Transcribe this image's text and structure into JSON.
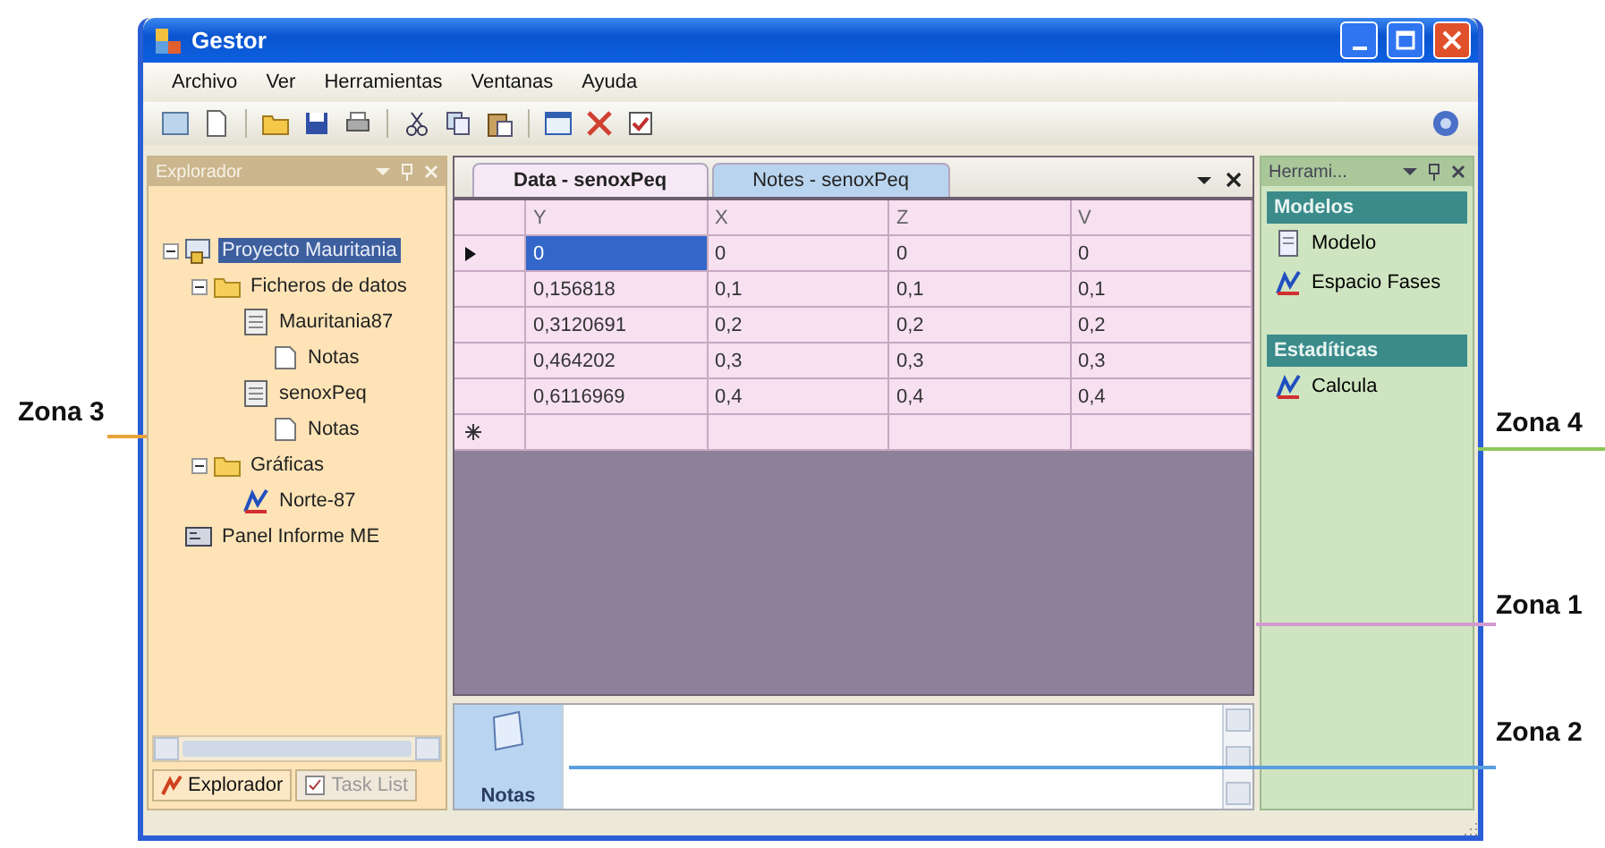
{
  "window": {
    "title": "Gestor"
  },
  "menu": [
    "Archivo",
    "Ver",
    "Herramientas",
    "Ventanas",
    "Ayuda"
  ],
  "explorer": {
    "title": "Explorador",
    "tree": [
      {
        "label": "Proyecto Mauritania",
        "kind": "project",
        "selected": true,
        "expanded": true,
        "children": [
          {
            "label": "Ficheros de datos",
            "kind": "folder",
            "selected": false,
            "expanded": true,
            "children": [
              {
                "label": "Mauritania87",
                "kind": "table",
                "selected": false,
                "children": [
                  {
                    "label": "Notas",
                    "kind": "note",
                    "selected": false
                  }
                ]
              },
              {
                "label": "senoxPeq",
                "kind": "table",
                "selected": false,
                "children": [
                  {
                    "label": "Notas",
                    "kind": "note",
                    "selected": false
                  }
                ]
              }
            ]
          },
          {
            "label": "Gráficas",
            "kind": "folder",
            "selected": false,
            "expanded": true,
            "children": [
              {
                "label": "Norte-87",
                "kind": "chart",
                "selected": false
              }
            ]
          }
        ]
      },
      {
        "label": "Panel Informe ME",
        "kind": "panel",
        "selected": false
      }
    ],
    "tabs": [
      {
        "label": "Explorador",
        "selected": true
      },
      {
        "label": "Task List",
        "selected": false
      }
    ]
  },
  "documents": {
    "tabs": [
      {
        "label": "Data - senoxPeq",
        "selected": true
      },
      {
        "label": "Notes - senoxPeq",
        "selected": false
      }
    ],
    "grid": {
      "columns": [
        "Y",
        "X",
        "Z",
        "V"
      ],
      "rows": [
        {
          "selected": true,
          "cells": [
            "0",
            "0",
            "0",
            "0"
          ]
        },
        {
          "selected": false,
          "cells": [
            "0,156818",
            "0,1",
            "0,1",
            "0,1"
          ]
        },
        {
          "selected": false,
          "cells": [
            "0,3120691",
            "0,2",
            "0,2",
            "0,2"
          ]
        },
        {
          "selected": false,
          "cells": [
            "0,464202",
            "0,3",
            "0,3",
            "0,3"
          ]
        },
        {
          "selected": false,
          "cells": [
            "0,6116969",
            "0,4",
            "0,4",
            "0,4"
          ]
        }
      ],
      "new_row": true
    }
  },
  "notes_panel": {
    "button": {
      "label": "Notas",
      "selected": true
    }
  },
  "tools": {
    "title": "Herrami...",
    "sections": [
      {
        "title": "Modelos",
        "items": [
          {
            "label": "Modelo",
            "kind": "model"
          },
          {
            "label": "Espacio Fases",
            "kind": "chart"
          }
        ]
      },
      {
        "title": "Estadíticas",
        "items": [
          {
            "label": "Calcula",
            "kind": "chart"
          }
        ]
      }
    ]
  },
  "annotations": [
    {
      "label": "Zona 3",
      "color": "#e8a33a"
    },
    {
      "label": "Zona 4",
      "color": "#8cc85a"
    },
    {
      "label": "Zona 1",
      "color": "#d49ad0"
    },
    {
      "label": "Zona 2",
      "color": "#5a9ee0"
    }
  ]
}
